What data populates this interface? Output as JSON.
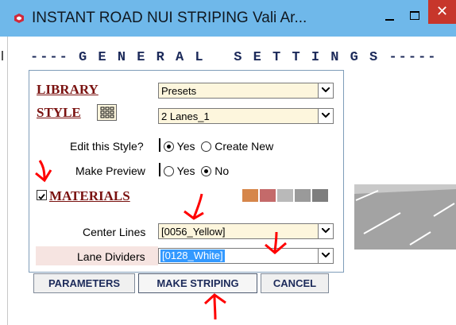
{
  "window": {
    "title": "INSTANT ROAD NUI STRIPING  Vali Ar...",
    "close_glyph": "✕",
    "icons": [
      "app-sketchup-icon",
      "minimize-icon",
      "maximize-icon",
      "close-icon"
    ]
  },
  "panel": {
    "header": "---- G E N E R A L   S E T T I N G S -----",
    "library": {
      "label": "LIBRARY",
      "value": "Presets"
    },
    "style": {
      "label": "STYLE",
      "value": "2 Lanes_1",
      "icon": "grid-icon"
    },
    "edit_style": {
      "label": "Edit this Style?",
      "options": [
        "Yes",
        "Create New"
      ],
      "selected": "Yes"
    },
    "make_preview": {
      "label": "Make Preview",
      "options": [
        "Yes",
        "No"
      ],
      "selected": "No"
    },
    "materials": {
      "label": "MATERIALS",
      "checked": true,
      "swatch_colors": [
        "#d6864a",
        "#c46a6a",
        "#b9b9b9",
        "#9a9a9a",
        "#7e7e7e"
      ]
    },
    "center_lines": {
      "label": "Center Lines",
      "value": "[0056_Yellow]"
    },
    "lane_dividers": {
      "label": "Lane Dividers",
      "value": "[0128_White]"
    }
  },
  "buttons": {
    "parameters": "PARAMETERS",
    "make_striping": "MAKE STRIPING",
    "cancel": "CANCEL"
  },
  "annotations": {
    "color": "#ff0000",
    "marks": [
      "arrow-down",
      "arrow-down",
      "arrow-down",
      "arrow-up"
    ]
  }
}
